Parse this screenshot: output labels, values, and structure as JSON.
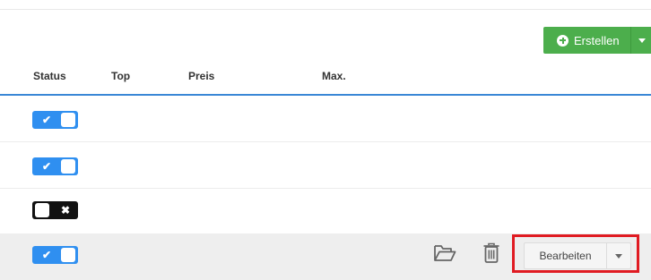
{
  "toolbar": {
    "create_label": "Erstellen",
    "create_icon": "plus-circle-icon",
    "dropdown_icon": "caret-down-icon",
    "accent": "#4cae4c"
  },
  "table": {
    "columns": [
      "Status",
      "Top",
      "Preis",
      "Max."
    ],
    "header_line_color": "#3a87d6",
    "rows": [
      {
        "status": "on",
        "status_mark": "✔"
      },
      {
        "status": "on",
        "status_mark": "✔"
      },
      {
        "status": "off",
        "status_mark": "✖"
      },
      {
        "status": "on",
        "status_mark": "✔",
        "highlighted": true
      }
    ]
  },
  "row_actions": {
    "folder_icon": "folder-open-icon",
    "trash_icon": "trash-icon",
    "edit_label": "Bearbeiten",
    "dropdown_icon": "caret-down-icon",
    "highlight_color": "#e01b22"
  },
  "colors": {
    "toggle_on": "#2f8ff0",
    "toggle_off": "#111111"
  }
}
